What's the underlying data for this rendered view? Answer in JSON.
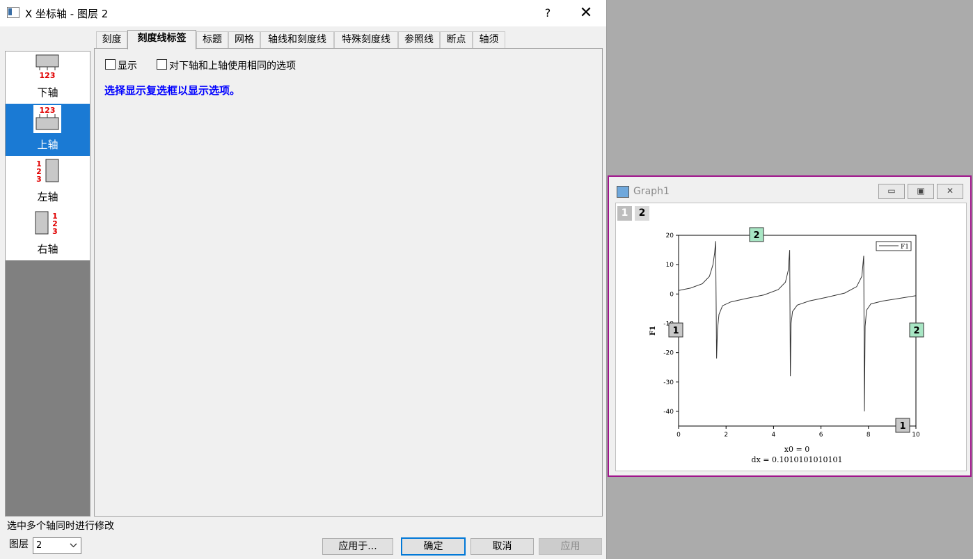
{
  "dialog": {
    "title": "X 坐标轴 - 图层 2",
    "help_label": "?",
    "close_label": "✕"
  },
  "axis_list": [
    {
      "label": "下轴",
      "icon": "bottom-axis-icon",
      "selected": false
    },
    {
      "label": "上轴",
      "icon": "top-axis-icon",
      "selected": true
    },
    {
      "label": "左轴",
      "icon": "left-axis-icon",
      "selected": false
    },
    {
      "label": "右轴",
      "icon": "right-axis-icon",
      "selected": false
    }
  ],
  "axis_icon_ticks": "123",
  "tabs": [
    {
      "label": "刻度"
    },
    {
      "label": "刻度线标签",
      "active": true
    },
    {
      "label": "标题"
    },
    {
      "label": "网格"
    },
    {
      "label": "轴线和刻度线"
    },
    {
      "label": "特殊刻度线"
    },
    {
      "label": "参照线"
    },
    {
      "label": "断点"
    },
    {
      "label": "轴须"
    }
  ],
  "panel": {
    "show_label": "显示",
    "show_checked": false,
    "same_options_label": "对下轴和上轴使用相同的选项",
    "same_options_checked": false,
    "hint": "选择显示复选框以显示选项。"
  },
  "footer": {
    "note": "选中多个轴同时进行修改",
    "layer_label": "图层",
    "layer_value": "2",
    "apply_to_label": "应用于...",
    "ok_label": "确定",
    "cancel_label": "取消",
    "apply_label": "应用"
  },
  "graph_window": {
    "title": "Graph1",
    "layer_tabs": [
      "1",
      "2"
    ],
    "min_icon": "minimize-icon",
    "restore_icon": "restore-icon",
    "close_icon": "close-icon",
    "colors": {
      "frame": "#a0158c",
      "layer2_badge": "#a8e6c4",
      "layer1_badge": "#c8c8c8"
    }
  },
  "chart_data": {
    "type": "line",
    "ylabel": "F1",
    "legend": [
      "F1"
    ],
    "legend_position": "top-right",
    "xlim": [
      0,
      10
    ],
    "ylim": [
      -45,
      20
    ],
    "x_ticks": [
      "0",
      "2",
      "4",
      "6",
      "8",
      "10"
    ],
    "y_ticks": [
      "20",
      "10",
      "0",
      "-10",
      "-20",
      "-30",
      "-40"
    ],
    "annotation_lines": [
      "x0 = 0",
      "dx = 0.1010101010101"
    ],
    "layer_badges": {
      "top": "2",
      "right": "2",
      "left": "1",
      "bottom": "1"
    },
    "series": [
      {
        "name": "F1",
        "x": [
          0,
          0.5,
          1.0,
          1.3,
          1.45,
          1.52,
          1.56,
          1.6,
          1.64,
          1.7,
          1.85,
          2.2,
          2.8,
          3.6,
          4.2,
          4.5,
          4.62,
          4.68,
          4.71,
          4.74,
          4.8,
          5.0,
          5.5,
          6.2,
          7.0,
          7.5,
          7.72,
          7.8,
          7.83,
          7.86,
          7.92,
          8.1,
          8.6,
          9.3,
          10.0
        ],
        "y": [
          1.2,
          2,
          3.5,
          6,
          10,
          14,
          18,
          -22,
          -12,
          -7,
          -4,
          -2.7,
          -1.6,
          -0.3,
          1.5,
          4,
          8,
          15,
          -28,
          -10,
          -6,
          -3.8,
          -2.4,
          -1.2,
          0.3,
          2.5,
          6,
          13,
          -40,
          -11,
          -5.5,
          -3.4,
          -2.4,
          -1.5,
          -0.6
        ]
      }
    ]
  }
}
